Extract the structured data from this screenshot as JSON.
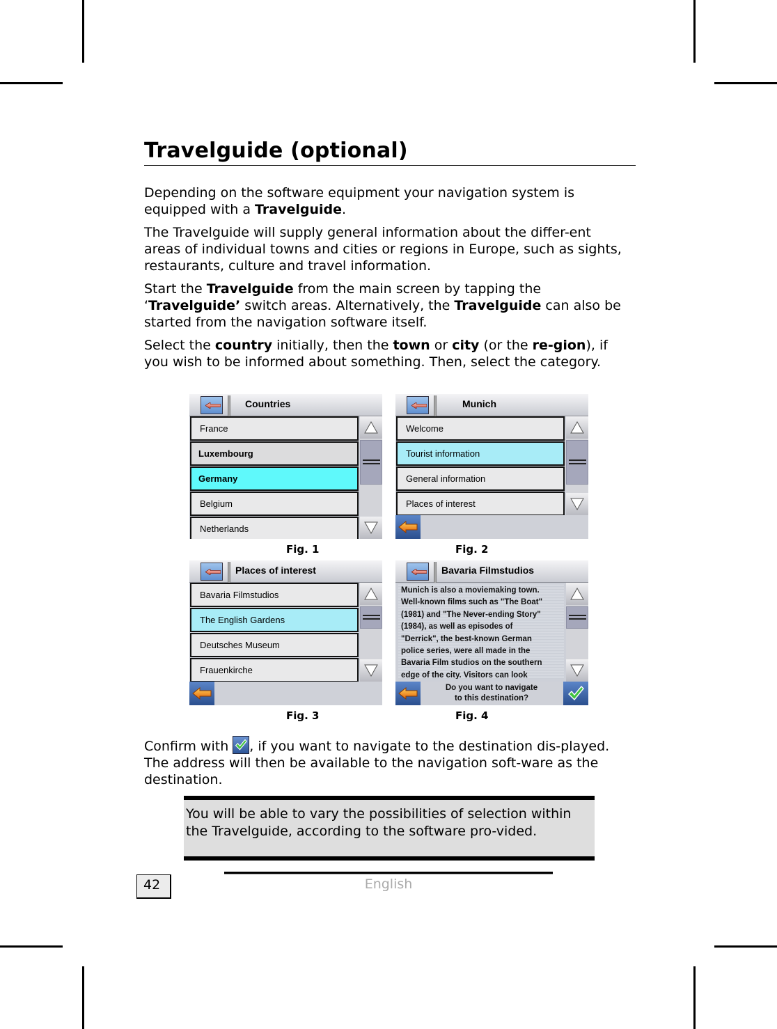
{
  "page": {
    "title": "Travelguide (optional)",
    "page_number": "42",
    "footer_language": "English"
  },
  "paragraphs": {
    "p1": [
      {
        "text": "Depending on the software equipment your navigation system is equipped with a ",
        "bold": false
      },
      {
        "text": "Travelguide",
        "bold": true
      },
      {
        "text": ".",
        "bold": false
      }
    ],
    "p2": [
      {
        "text": "The Travelguide will supply general information about the differ-ent areas of individual towns and cities or regions in Europe, such as sights, restaurants, culture and travel information.",
        "bold": false
      }
    ],
    "p3": [
      {
        "text": "Start the ",
        "bold": false
      },
      {
        "text": "Travelguide",
        "bold": true
      },
      {
        "text": " from the main screen by tapping the ‘",
        "bold": false
      },
      {
        "text": "Travelguide’",
        "bold": true
      },
      {
        "text": " switch areas. Alternatively, the ",
        "bold": false
      },
      {
        "text": "Travelguide",
        "bold": true
      },
      {
        "text": " can also be started from the navigation software itself.",
        "bold": false
      }
    ],
    "p4": [
      {
        "text": "Select the ",
        "bold": false
      },
      {
        "text": "country",
        "bold": true
      },
      {
        "text": " initially, then the ",
        "bold": false
      },
      {
        "text": "town",
        "bold": true
      },
      {
        "text": " or ",
        "bold": false
      },
      {
        "text": "city",
        "bold": true
      },
      {
        "text": " (or the ",
        "bold": false
      },
      {
        "text": "re-gion",
        "bold": true
      },
      {
        "text": "), if you wish to be informed about something. Then, select the category.",
        "bold": false
      }
    ],
    "confirm_before": "Confirm with ",
    "confirm_after": ", if you want to navigate to the destination dis-played. The address will then be available to the navigation soft-ware as the destination."
  },
  "note": {
    "text": "You will be able to vary the possibilities of selection within the Travelguide, according to the software pro-vided."
  },
  "figures": {
    "fig1": {
      "label": "Fig. 1",
      "header_title": "Countries",
      "items": [
        {
          "label": "France",
          "style": "normal"
        },
        {
          "label": "Luxembourg",
          "style": "bold-alt"
        },
        {
          "label": "Germany",
          "style": "bold-selected"
        },
        {
          "label": "Belgium",
          "style": "normal"
        },
        {
          "label": "Netherlands",
          "style": "normal"
        }
      ]
    },
    "fig2": {
      "label": "Fig. 2",
      "header_title": "Munich",
      "items": [
        {
          "label": "Welcome",
          "style": "normal"
        },
        {
          "label": "Tourist information",
          "style": "selected"
        },
        {
          "label": "General information",
          "style": "normal"
        },
        {
          "label": "Places of interest",
          "style": "normal"
        }
      ]
    },
    "fig3": {
      "label": "Fig. 3",
      "header_title": "Places of interest",
      "items": [
        {
          "label": "Bavaria Filmstudios",
          "style": "normal"
        },
        {
          "label": "The English Gardens",
          "style": "selected"
        },
        {
          "label": "Deutsches Museum",
          "style": "normal"
        },
        {
          "label": "Frauenkirche",
          "style": "normal"
        }
      ]
    },
    "fig4": {
      "label": "Fig. 4",
      "header_title": "Bavaria Filmstudios",
      "info_lines": [
        "Munich is also a moviemaking town.",
        "Well-known films such as \"The Boat\"",
        "(1981) and \"The Never-ending Story\"",
        "(1984), as well as episodes of",
        "\"Derrick\", the best-known German",
        "police series, were all made in the",
        "Bavaria Film studios on the southern",
        "edge of the city. Visitors can look"
      ],
      "prompt_line1": "Do you want to navigate",
      "prompt_line2": "to this destination?"
    }
  },
  "icons": {
    "back": "back-arrow-icon",
    "scroll_up": "triangle-up-icon",
    "scroll_down": "triangle-down-icon",
    "confirm": "checkmark-icon"
  },
  "colors": {
    "selected_cyan": "#5ff9fb",
    "selected_light": "#a8ecf7",
    "button_blue": "#2b4f8e",
    "check_green": "#3fc43f",
    "arrow_orange": "#f08a10"
  }
}
